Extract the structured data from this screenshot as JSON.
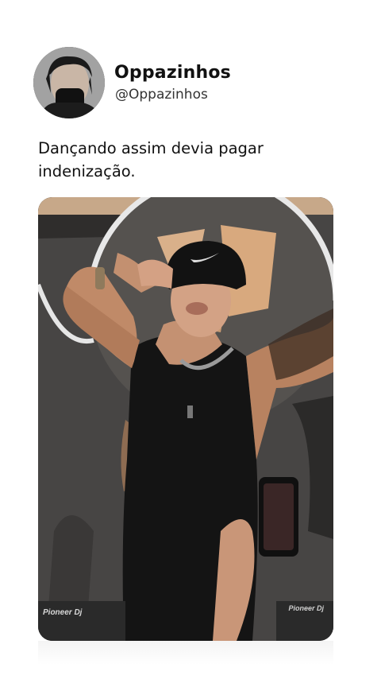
{
  "tweet": {
    "author": {
      "display_name": "Oppazinhos",
      "handle": "@Oppazinhos",
      "avatar_icon": "profile-photo"
    },
    "text": "Dançando assim devia pagar\nindenização.",
    "media": {
      "type": "video-frame",
      "overlay_left": "Pioneer Dj",
      "overlay_right": "Pioneer Dj"
    }
  },
  "colors": {
    "background": "#ffffff",
    "text": "#111111",
    "handle": "#333333"
  }
}
